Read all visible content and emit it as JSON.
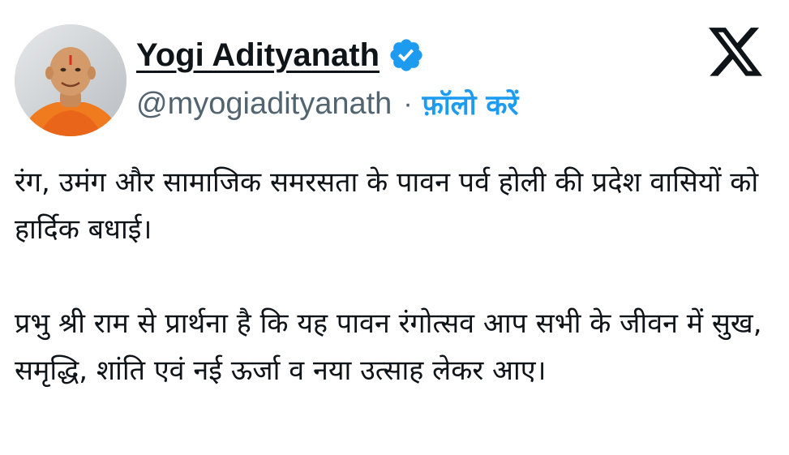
{
  "author": {
    "name": "Yogi Adityanath",
    "handle": "@myogiadityanath",
    "separator": "·",
    "follow_label": "फ़ॉलो करें",
    "avatar_icon": "profile-photo",
    "verified_icon": "verified-badge-icon"
  },
  "platform": {
    "logo_icon": "x-logo-icon"
  },
  "tweet": {
    "paragraph_1": "रंग, उमंग और सामाजिक समरसता के पावन पर्व होली की प्रदेश वासियों को हार्दिक बधाई।",
    "paragraph_2": "प्रभु श्री राम से प्रार्थना है कि यह पावन रंगोत्सव आप सभी के जीवन में सुख, समृद्धि, शांति एवं नई ऊर्जा व नया उत्साह लेकर आए।"
  },
  "colors": {
    "text_primary": "#0f1419",
    "text_secondary": "#536471",
    "accent": "#1d9bf0",
    "background": "#ffffff"
  }
}
